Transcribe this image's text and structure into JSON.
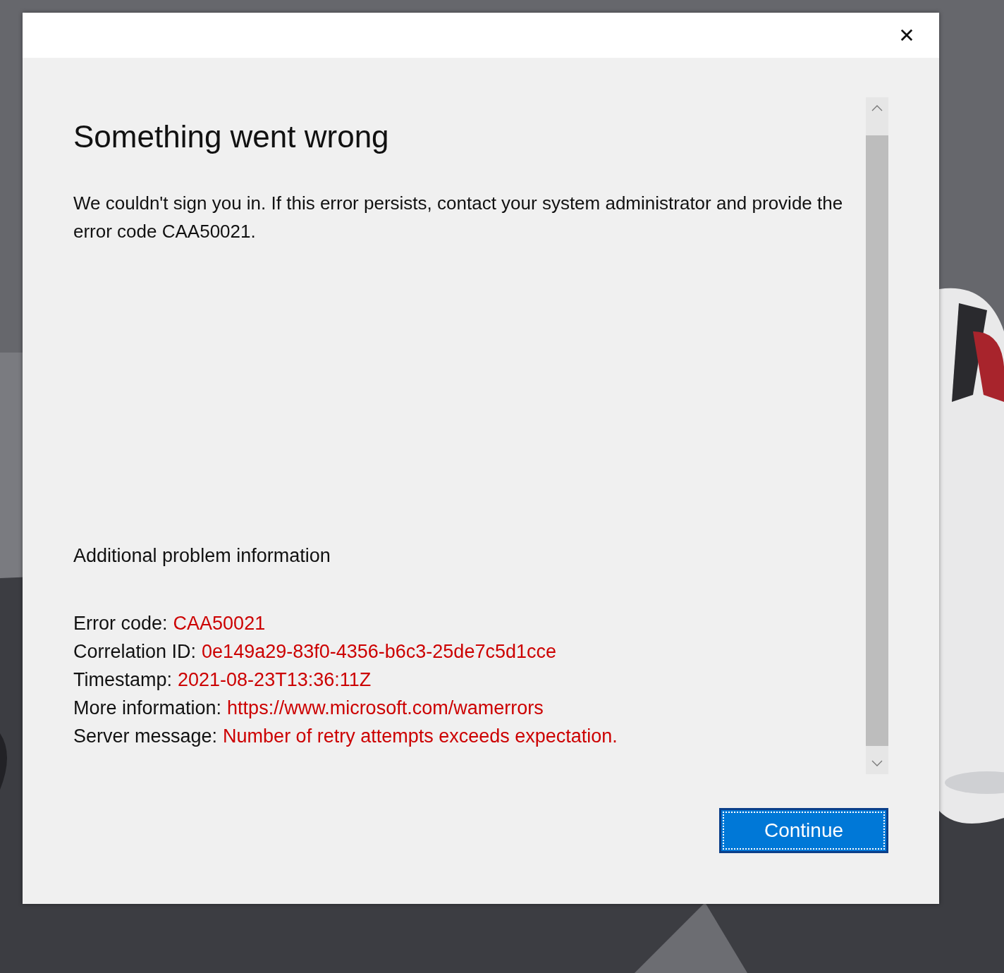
{
  "dialog": {
    "close": "✕",
    "heading": "Something went wrong",
    "message": "We couldn't sign you in. If this error persists, contact your system administrator and provide the error code CAA50021.",
    "details_heading": "Additional problem information",
    "details": [
      {
        "label": "Error code:",
        "value": "CAA50021"
      },
      {
        "label": "Correlation ID:",
        "value": "0e149a29-83f0-4356-b6c3-25de7c5d1cce"
      },
      {
        "label": "Timestamp:",
        "value": "2021-08-23T13:36:11Z"
      },
      {
        "label": "More information:",
        "value": "https://www.microsoft.com/wamerrors"
      },
      {
        "label": "Server message:",
        "value": "Number of retry attempts exceeds expectation."
      }
    ],
    "button": {
      "label": "Continue",
      "focused": true
    }
  }
}
